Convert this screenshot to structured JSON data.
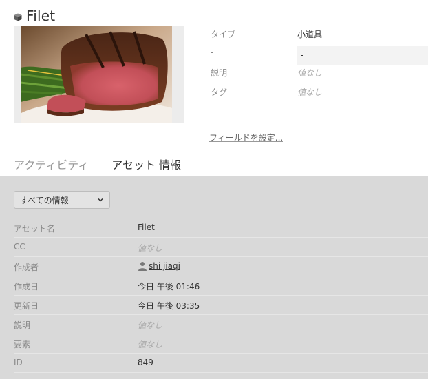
{
  "asset": {
    "title": "Filet",
    "icon": "cube-icon"
  },
  "properties": [
    {
      "key": "タイプ",
      "value": "小道具",
      "style": "normal"
    },
    {
      "key": "-",
      "value": "-",
      "style": "filled"
    },
    {
      "key": "説明",
      "value": "値なし",
      "style": "empty"
    },
    {
      "key": "タグ",
      "value": "値なし",
      "style": "empty"
    }
  ],
  "config_link": "フィールドを設定...",
  "tabs": [
    {
      "label": "アクティビティ",
      "active": false
    },
    {
      "label": "アセット 情報",
      "active": true
    }
  ],
  "filter": {
    "selected": "すべての情報"
  },
  "info_rows": [
    {
      "key": "アセット名",
      "value": "Filet",
      "style": "normal"
    },
    {
      "key": "CC",
      "value": "値なし",
      "style": "empty"
    },
    {
      "key": "作成者",
      "value": "shi jiaqi",
      "style": "user"
    },
    {
      "key": "作成日",
      "value": "今日 午後 01:46",
      "style": "normal"
    },
    {
      "key": "更新日",
      "value": "今日 午後 03:35",
      "style": "normal"
    },
    {
      "key": "説明",
      "value": "値なし",
      "style": "empty"
    },
    {
      "key": "要素",
      "value": "値なし",
      "style": "empty"
    },
    {
      "key": "ID",
      "value": "849",
      "style": "normal"
    }
  ],
  "colors": {
    "panel_bg": "#d9d9d9",
    "muted_text": "#888888",
    "empty_text": "#aaaaaa"
  }
}
